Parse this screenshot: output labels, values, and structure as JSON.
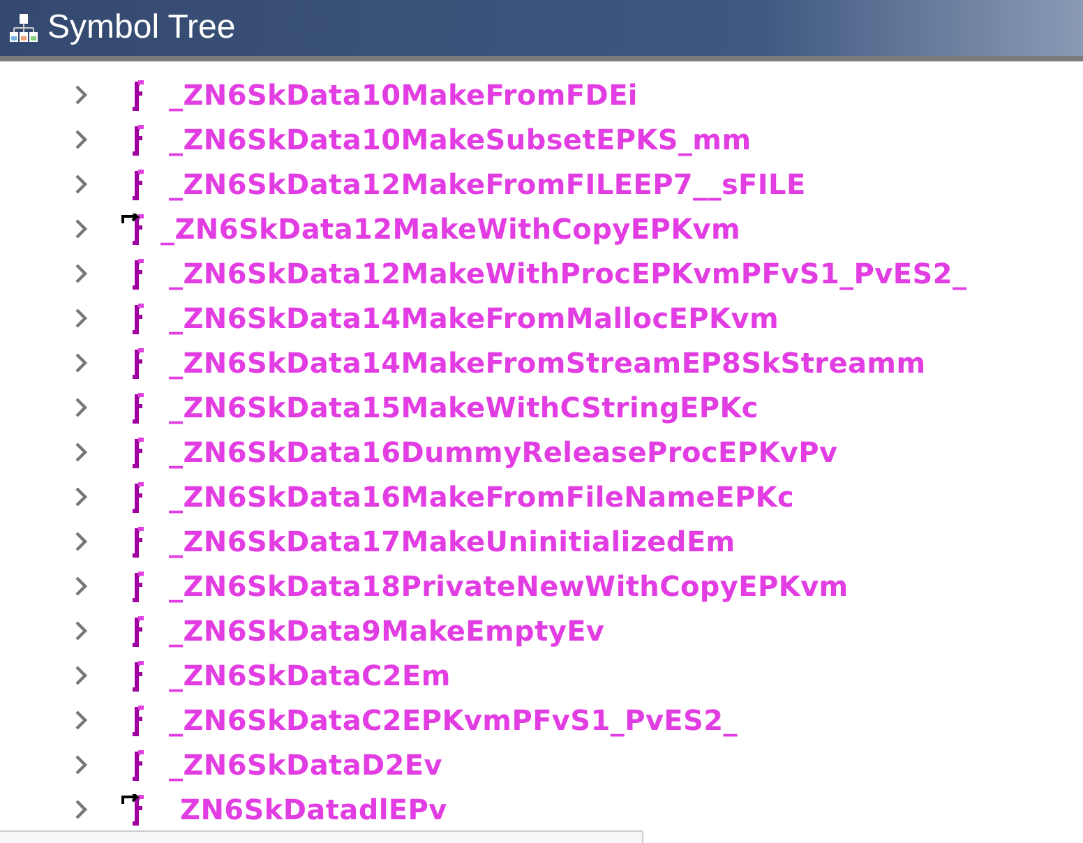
{
  "panel": {
    "title": "Symbol Tree"
  },
  "symbols": [
    {
      "name": "_ZN6SkData10MakeFromFDEi",
      "kind": "function"
    },
    {
      "name": "_ZN6SkData10MakeSubsetEPKS_mm",
      "kind": "function"
    },
    {
      "name": "_ZN6SkData12MakeFromFILEEP7__sFILE",
      "kind": "function"
    },
    {
      "name": "_ZN6SkData12MakeWithCopyEPKvm",
      "kind": "thunk"
    },
    {
      "name": "_ZN6SkData12MakeWithProcEPKvmPFvS1_PvES2_",
      "kind": "function"
    },
    {
      "name": "_ZN6SkData14MakeFromMallocEPKvm",
      "kind": "function"
    },
    {
      "name": "_ZN6SkData14MakeFromStreamEP8SkStreamm",
      "kind": "function"
    },
    {
      "name": "_ZN6SkData15MakeWithCStringEPKc",
      "kind": "function"
    },
    {
      "name": "_ZN6SkData16DummyReleaseProcEPKvPv",
      "kind": "function"
    },
    {
      "name": "_ZN6SkData16MakeFromFileNameEPKc",
      "kind": "function"
    },
    {
      "name": "_ZN6SkData17MakeUninitializedEm",
      "kind": "function"
    },
    {
      "name": "_ZN6SkData18PrivateNewWithCopyEPKvm",
      "kind": "function"
    },
    {
      "name": "_ZN6SkData9MakeEmptyEv",
      "kind": "function"
    },
    {
      "name": "_ZN6SkDataC2Em",
      "kind": "function"
    },
    {
      "name": "_ZN6SkDataC2EPKvmPFvS1_PvES2_",
      "kind": "function"
    },
    {
      "name": "_ZN6SkDataD2Ev",
      "kind": "function"
    },
    {
      "name": "ZN6SkDatadlEPv",
      "kind": "thunk"
    }
  ]
}
